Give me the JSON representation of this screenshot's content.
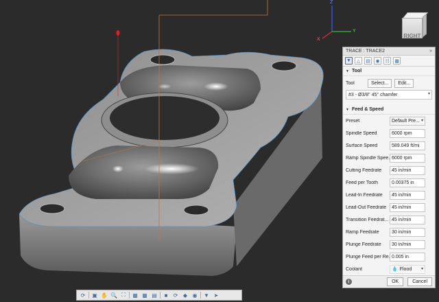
{
  "viewcube": {
    "face_label": "RIGHT"
  },
  "axes": {
    "z": "Z",
    "y": "Y",
    "x": "X"
  },
  "panel": {
    "title": "TRACE : TRACE2",
    "collapse_glyph": "»",
    "tabs": [
      "tool-tab-icon",
      "geometry-tab-icon",
      "heights-tab-icon",
      "passes-tab-icon",
      "linking-tab-icon",
      "simulation-tab-icon"
    ],
    "tool_section": {
      "title": "Tool",
      "tool_label": "Tool",
      "select_label": "Select...",
      "edit_label": "Edit...",
      "tool_value": "#3 - Ø3/8\" 45° chamfer"
    },
    "feed_section": {
      "title": "Feed & Speed",
      "rows": [
        {
          "label": "Preset",
          "value": "Default Pre..."
        },
        {
          "label": "Spindle Speed",
          "value": "6000 rpm"
        },
        {
          "label": "Surface Speed",
          "value": "589.049 ft/mi"
        },
        {
          "label": "Ramp Spindle Spee...",
          "value": "6000 rpm"
        },
        {
          "label": "Cutting Feedrate",
          "value": "45 in/min"
        },
        {
          "label": "Feed per Tooth",
          "value": "0.00375 in"
        },
        {
          "label": "Lead-In Feedrate",
          "value": "45 in/min"
        },
        {
          "label": "Lead-Out Feedrate",
          "value": "45 in/min"
        },
        {
          "label": "Transition Feedrat...",
          "value": "45 in/min"
        },
        {
          "label": "Ramp Feedrate",
          "value": "30 in/min"
        },
        {
          "label": "Plunge Feedrate",
          "value": "30 in/min"
        },
        {
          "label": "Plunge Feed per Re...",
          "value": "0.005 in"
        },
        {
          "label": "Coolant",
          "value": "Flood"
        }
      ]
    },
    "ok_label": "OK",
    "cancel_label": "Cancel"
  },
  "colors": {
    "accent": "#3a6ea8",
    "axis_x": "#e03030",
    "axis_y": "#30c030",
    "axis_z": "#3060ff"
  }
}
